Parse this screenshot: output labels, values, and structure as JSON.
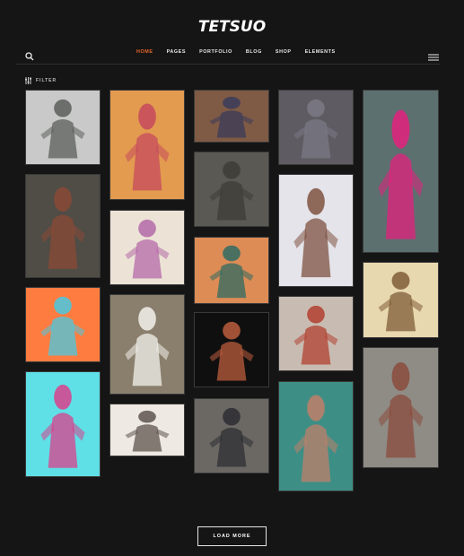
{
  "header": {
    "logo": "TETSUO"
  },
  "nav": {
    "items": [
      {
        "label": "HOME",
        "active": true
      },
      {
        "label": "PAGES",
        "active": false
      },
      {
        "label": "PORTFOLIO",
        "active": false
      },
      {
        "label": "BLOG",
        "active": false
      },
      {
        "label": "SHOP",
        "active": false
      },
      {
        "label": "ELEMENTS",
        "active": false
      }
    ],
    "accent_color": "#e8672a"
  },
  "filter": {
    "label": "FILTER"
  },
  "gallery": {
    "items": [
      {
        "name": "gallery-item-1",
        "bg": "#c9c9c9",
        "fg": "#5b5e59"
      },
      {
        "name": "gallery-item-2",
        "bg": "#504c46",
        "fg": "#8a4a36"
      },
      {
        "name": "gallery-item-3",
        "bg": "#ff7c40",
        "fg": "#49c9e0"
      },
      {
        "name": "gallery-item-4",
        "bg": "#5fe0e6",
        "fg": "#d9408c"
      },
      {
        "name": "gallery-item-5",
        "bg": "#e39b4f",
        "fg": "#c64a5d"
      },
      {
        "name": "gallery-item-6",
        "bg": "#ece3d6",
        "fg": "#b56aa8"
      },
      {
        "name": "gallery-item-7",
        "bg": "#8a7f6c",
        "fg": "#f2f1ec"
      },
      {
        "name": "gallery-item-8",
        "bg": "#eee9e2",
        "fg": "#5d544c"
      },
      {
        "name": "gallery-item-9",
        "bg": "#7f5a45",
        "fg": "#3a3c5a"
      },
      {
        "name": "gallery-item-10",
        "bg": "#5b5954",
        "fg": "#3e3c36"
      },
      {
        "name": "gallery-item-11",
        "bg": "#dd8c56",
        "fg": "#2f6b61"
      },
      {
        "name": "gallery-item-12",
        "bg": "#100f10",
        "fg": "#bb5d3c"
      },
      {
        "name": "gallery-item-13",
        "bg": "#6b6864",
        "fg": "#2d2d31"
      },
      {
        "name": "gallery-item-14",
        "bg": "#5e5c62",
        "fg": "#7b7986"
      },
      {
        "name": "gallery-item-15",
        "bg": "#e4e4ea",
        "fg": "#7f5240"
      },
      {
        "name": "gallery-item-16",
        "bg": "#c8bcb2",
        "fg": "#b2402f"
      },
      {
        "name": "gallery-item-17",
        "bg": "#3d8f86",
        "fg": "#c07f69"
      },
      {
        "name": "gallery-item-18",
        "bg": "#5d7070",
        "fg": "#e4207e"
      },
      {
        "name": "gallery-item-19",
        "bg": "#e8d8b0",
        "fg": "#7f5d37"
      },
      {
        "name": "gallery-item-20",
        "bg": "#8e8c85",
        "fg": "#8b4b3d"
      }
    ]
  },
  "load_more": {
    "label": "LOAD MORE"
  }
}
